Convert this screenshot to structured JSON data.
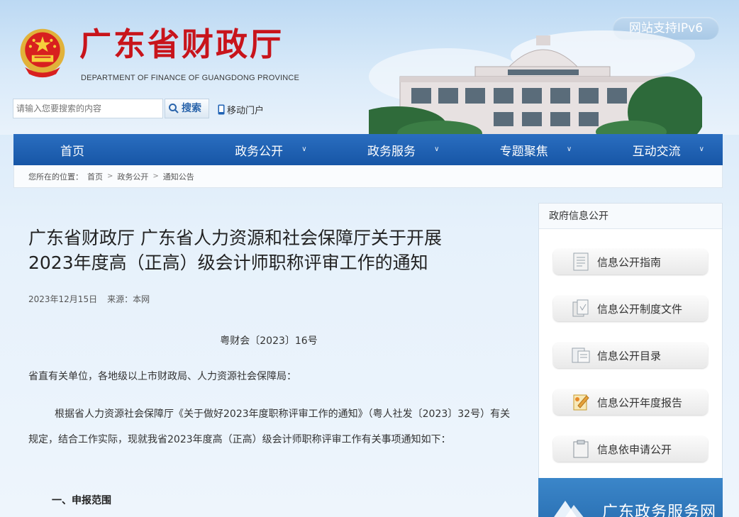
{
  "header": {
    "site_title": "广东省财政厅",
    "site_subtitle": "DEPARTMENT OF FINANCE OF GUANGDONG PROVINCE",
    "ipv6_badge": "网站支持IPv6",
    "search_placeholder": "请输入您要搜索的内容",
    "search_button": "搜索",
    "mobile_link": "移动门户"
  },
  "nav": {
    "items": [
      {
        "label": "首页",
        "dropdown": false
      },
      {
        "label": "政务公开",
        "dropdown": true
      },
      {
        "label": "政务服务",
        "dropdown": true
      },
      {
        "label": "专题聚焦",
        "dropdown": true
      },
      {
        "label": "互动交流",
        "dropdown": true
      }
    ]
  },
  "breadcrumb": {
    "prefix": "您所在的位置：",
    "items": [
      "首页",
      "政务公开",
      "通知公告"
    ],
    "separator": ">"
  },
  "article": {
    "title_line1": "广东省财政厅 广东省人力资源和社会保障厅关于开展",
    "title_line2": "2023年度高（正高）级会计师职称评审工作的通知",
    "date": "2023年12月15日",
    "source": "来源：本网",
    "doc_number": "粤财会〔2023〕16号",
    "addressee": "省直有关单位，各地级以上市财政局、人力资源社会保障局：",
    "body": "根据省人力资源社会保障厅《关于做好2023年度职称评审工作的通知》（粤人社发〔2023〕32号）有关规定，结合工作实际，现就我省2023年度高（正高）级会计师职称评审工作有关事项通知如下：",
    "section1_heading": "一、申报范围"
  },
  "sidebar": {
    "heading": "政府信息公开",
    "buttons": [
      {
        "label": "信息公开指南",
        "icon": "document-icon"
      },
      {
        "label": "信息公开制度文件",
        "icon": "files-icon"
      },
      {
        "label": "信息公开目录",
        "icon": "folder-list-icon"
      },
      {
        "label": "信息公开年度报告",
        "icon": "report-pencil-icon"
      },
      {
        "label": "信息依申请公开",
        "icon": "clipboard-icon"
      }
    ],
    "banner_text": "广东政务服务网"
  },
  "colors": {
    "title_red": "#c8141b",
    "nav_blue": "#1e62b4",
    "ipv6_badge": "#a9c9e6"
  }
}
